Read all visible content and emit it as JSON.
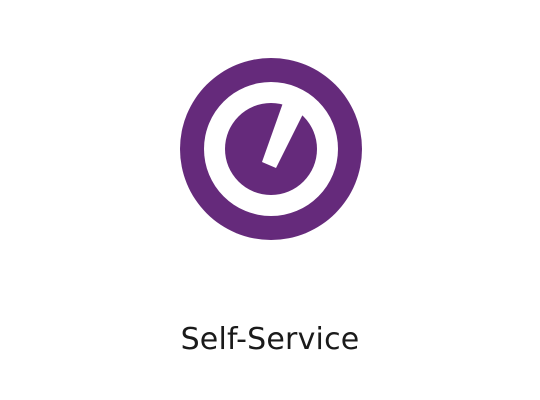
{
  "app": {
    "label": "Self-Service",
    "icon": "self-service-app-icon",
    "accent_color": "#652a7b"
  }
}
